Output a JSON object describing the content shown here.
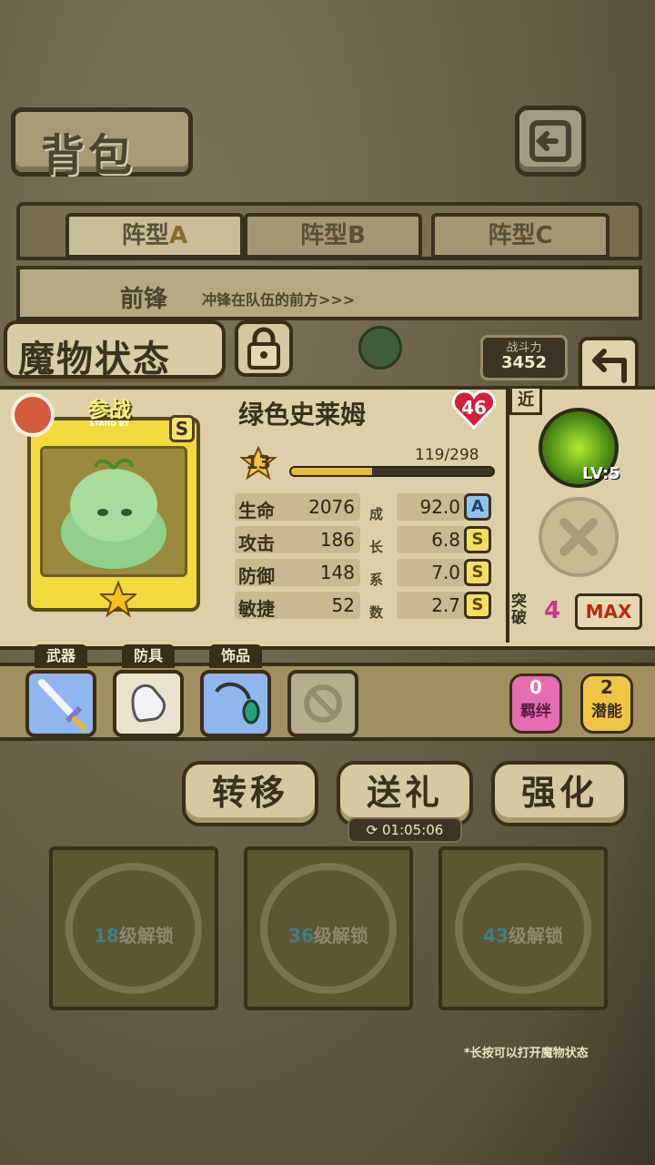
{
  "header": {
    "title": "背包"
  },
  "tabs": [
    {
      "label": "阵型",
      "letter": "A",
      "active": true
    },
    {
      "label": "阵型",
      "letter": "B",
      "active": false
    },
    {
      "label": "阵型",
      "letter": "C",
      "active": false
    }
  ],
  "banner": {
    "position": "前锋",
    "desc": "冲锋在队伍的前方>>>"
  },
  "status": {
    "title": "魔物状态"
  },
  "power": {
    "label": "战斗力",
    "value": "3452"
  },
  "monster": {
    "standby_label": "参战",
    "standby_sub": "STAND BY",
    "rank": "S",
    "name": "绿色史莱姆",
    "heart_level": "46",
    "level": "13",
    "exp_text": "119/298",
    "exp_fraction": 0.399
  },
  "stats": [
    {
      "key": "生命",
      "value": "2076",
      "growth": "92.0",
      "grade": "A"
    },
    {
      "key": "攻击",
      "value": "186",
      "growth": "6.8",
      "grade": "S"
    },
    {
      "key": "防御",
      "value": "148",
      "growth": "7.0",
      "grade": "S"
    },
    {
      "key": "敏捷",
      "value": "52",
      "growth": "2.7",
      "grade": "S"
    }
  ],
  "growth_label": [
    "成",
    "长",
    "系",
    "数"
  ],
  "side": {
    "range": "近",
    "skill_level": "LV:5",
    "break_label": "突破",
    "break_value": "4",
    "max_label": "MAX"
  },
  "equipment": [
    {
      "label": "武器",
      "icon": "sword-icon"
    },
    {
      "label": "防具",
      "icon": "glove-icon"
    },
    {
      "label": "饰品",
      "icon": "necklace-icon"
    }
  ],
  "bond": {
    "count": "0",
    "label": "羁绊"
  },
  "potential": {
    "count": "2",
    "label": "潜能"
  },
  "actions": {
    "transfer": "转移",
    "gift": "送礼",
    "enhance": "强化"
  },
  "timer": "01:05:06",
  "locked_slots": [
    {
      "level": "18",
      "text": "级解锁"
    },
    {
      "level": "36",
      "text": "级解锁"
    },
    {
      "level": "43",
      "text": "级解锁"
    }
  ],
  "hint": "*长按可以打开魔物状态",
  "colors": {
    "accent_yellow": "#f1d93e",
    "break_pink": "#c9358f",
    "max_red": "#b52d0c"
  }
}
